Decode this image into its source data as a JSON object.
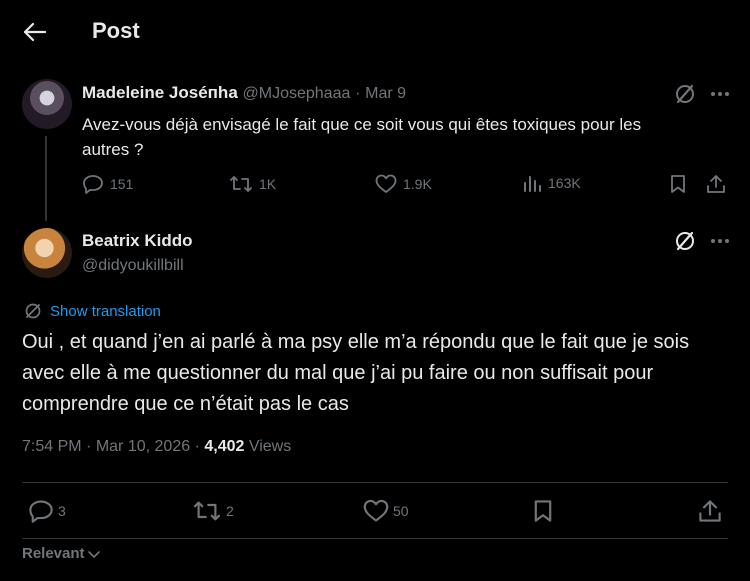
{
  "header": {
    "title": "Post"
  },
  "parent_post": {
    "author_name": "Madeleine Joséпha",
    "handle": "@MJosephaaa",
    "separator": "·",
    "date": "Mar 9",
    "text": "Avez-vous déjà envisagé le fait que ce soit vous qui êtes toxiques pour les autres ?",
    "replies": "151",
    "reposts": "1K",
    "likes": "1.9K",
    "views": "163K"
  },
  "main_post": {
    "author_name": "Beatrix Kiddo",
    "handle": "@didyoukillbill",
    "translate_label": "Show translation",
    "text": "Oui , et quand j’en ai parlé à ma psy elle m’a répondu que le fait que je sois avec elle à me questionner du mal que j’ai pu faire ou non suffisait pour comprendre que ce n’était pas le cas",
    "time": "7:54 PM",
    "dot": "·",
    "date": "Mar 10, 2026",
    "dot2": "·",
    "views_count": "4,402",
    "views_label": "Views",
    "replies": "3",
    "reposts": "2",
    "likes": "50"
  },
  "sort": {
    "label": "Relevant"
  },
  "colors": {
    "background": "#000000",
    "text": "#e7e9ea",
    "muted": "#71767b",
    "link": "#1d9bf0",
    "border": "#2f3336"
  }
}
